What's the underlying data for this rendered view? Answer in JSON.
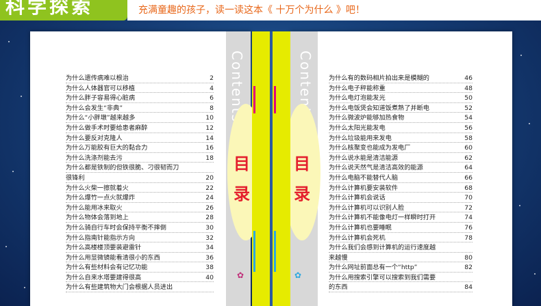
{
  "header": {
    "badge": "科学探索",
    "subtitle": "充满童趣的孩子，读一读这本《 十万个为什么 》吧！"
  },
  "spine": {
    "contents_word": "Contents",
    "mulu": [
      "目",
      "录"
    ]
  },
  "toc_left": [
    {
      "title": "为什么遗传病难以根治",
      "page": "2"
    },
    {
      "title": "为什么人体器官可以移植",
      "page": "4"
    },
    {
      "title": "为什么胖子容易得心脏病",
      "page": "6"
    },
    {
      "title": "为什么会发生“非典”",
      "page": "8"
    },
    {
      "title": "为什么“小胖墩”越来越多",
      "page": "10"
    },
    {
      "title": "为什么做手术时要给患者麻醉",
      "page": "12"
    },
    {
      "title": "为什么要反对克隆人",
      "page": "14"
    },
    {
      "title": "为什么万能胶有巨大的黏合力",
      "page": "16"
    },
    {
      "title": "为什么洗涤剂能去污",
      "page": "18"
    },
    {
      "title": "为什么都是铁制的但铁很脆、刁很韧而刀",
      "page": ""
    },
    {
      "title": "很锋利",
      "page": "20"
    },
    {
      "title": "为什么火柴一擦就着火",
      "page": "22"
    },
    {
      "title": "为什么爆竹一点火就爆炸",
      "page": "24"
    },
    {
      "title": "为什么能用冰来取火",
      "page": "26"
    },
    {
      "title": "为什么物体会落到地上",
      "page": "28"
    },
    {
      "title": "为什么骑自行车时会保持平衡不摔倒",
      "page": "30"
    },
    {
      "title": "为什么指南针能指示方向",
      "page": "32"
    },
    {
      "title": "为什么高楼楼顶要装避雷针",
      "page": "34"
    },
    {
      "title": "为什么用显微镜能看清很小的东西",
      "page": "36"
    },
    {
      "title": "为什么有些材料会有记忆功能",
      "page": "38"
    },
    {
      "title": "为什么自来水塔要建得很高",
      "page": "40"
    },
    {
      "title": "为什么有些建筑物大门会根据人员进出",
      "page": ""
    }
  ],
  "toc_right": [
    {
      "title": "为什么有的数码相片拍出来是模糊的",
      "page": "46"
    },
    {
      "title": "为什么电子秤能称重",
      "page": "48"
    },
    {
      "title": "为什么电灯泡能发光",
      "page": "50"
    },
    {
      "title": "为什么电饭煲会知道饭煮熟了并断电",
      "page": "52"
    },
    {
      "title": "为什么微波炉能够加热食物",
      "page": "54"
    },
    {
      "title": "为什么太阳光能发电",
      "page": "56"
    },
    {
      "title": "为什么垃圾能用来发电",
      "page": "58"
    },
    {
      "title": "为什么核聚变也能成为发电厂",
      "page": "60"
    },
    {
      "title": "为什么说水能是清洁能源",
      "page": "62"
    },
    {
      "title": "为什么说天然气是清洁高效的能源",
      "page": "64"
    },
    {
      "title": "为什么电脑不能替代人脑",
      "page": "66"
    },
    {
      "title": "为什么计算机要安装软件",
      "page": "68"
    },
    {
      "title": "为什么计算机会说话",
      "page": "70"
    },
    {
      "title": "为什么计算机可以识别人脸",
      "page": "72"
    },
    {
      "title": "为什么计算机不能像电灯一样瞬时打开",
      "page": "74"
    },
    {
      "title": "为什么计算机也要睡眠",
      "page": "76"
    },
    {
      "title": "为什么计算机会死机",
      "page": "78"
    },
    {
      "title": "为什么我们会感到计算机的运行速度越",
      "page": ""
    },
    {
      "title": "来越慢",
      "page": "80"
    },
    {
      "title": "为什么网址前面总有一个“http”",
      "page": "82"
    },
    {
      "title": "为什么用搜索引擎可以搜索到我们需要",
      "page": ""
    },
    {
      "title": "的东西",
      "page": "84"
    }
  ]
}
